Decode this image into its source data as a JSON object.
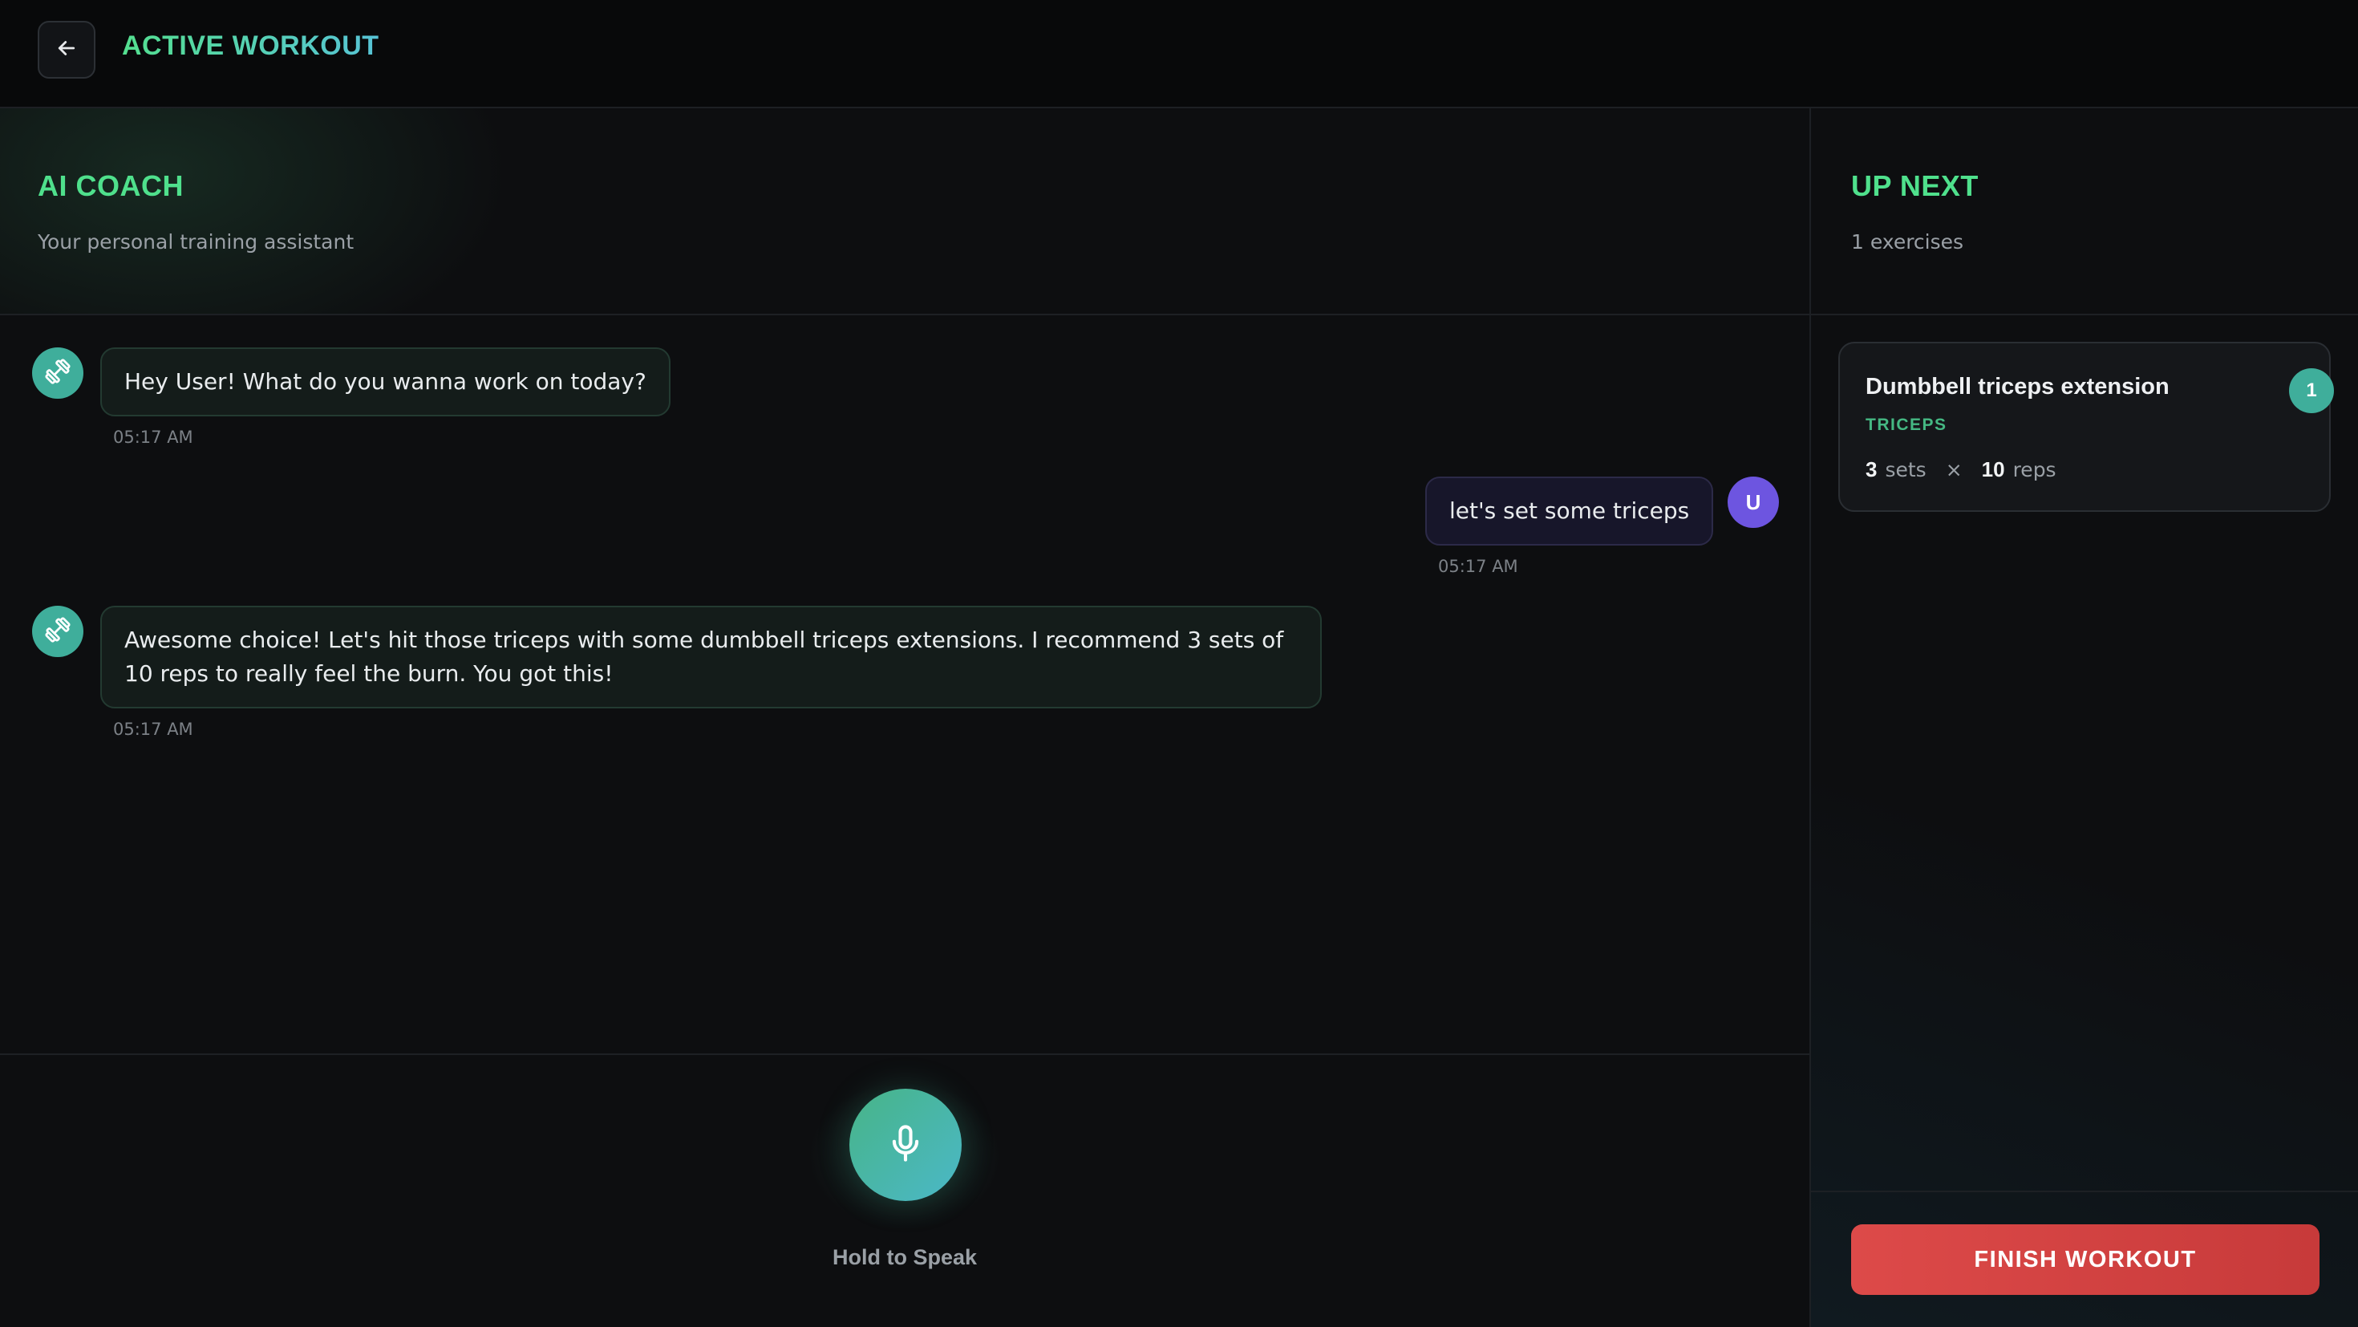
{
  "header": {
    "title": "ACTIVE WORKOUT",
    "back_icon": "arrow-left-icon"
  },
  "coach": {
    "title": "AI COACH",
    "subtitle": "Your personal training assistant",
    "messages": [
      {
        "sender": "ai",
        "text": "Hey User! What do you wanna work on today?",
        "time": "05:17 AM"
      },
      {
        "sender": "user",
        "avatar_initial": "U",
        "text": "let's set some triceps",
        "time": "05:17 AM"
      },
      {
        "sender": "ai",
        "text": "Awesome choice! Let's hit those triceps with some dumbbell triceps extensions. I recommend 3 sets of 10 reps to really feel the burn. You got this!",
        "time": "05:17 AM"
      }
    ],
    "voice_label": "Hold to Speak",
    "mic_icon": "microphone-icon",
    "ai_avatar_icon": "dumbbell-icon"
  },
  "up_next": {
    "title": "UP NEXT",
    "count_label": "1 exercises",
    "exercises": [
      {
        "number": "1",
        "name": "Dumbbell triceps extension",
        "muscle": "TRICEPS",
        "sets": "3",
        "sets_label": "sets",
        "times": "×",
        "reps": "10",
        "reps_label": "reps"
      }
    ],
    "finish_label": "FINISH WORKOUT"
  },
  "colors": {
    "accent_green": "#4fe08c",
    "accent_teal": "#3fae9b",
    "user_purple": "#6d55e0",
    "danger_red": "#dd4a49",
    "background": "#0d0e10"
  }
}
